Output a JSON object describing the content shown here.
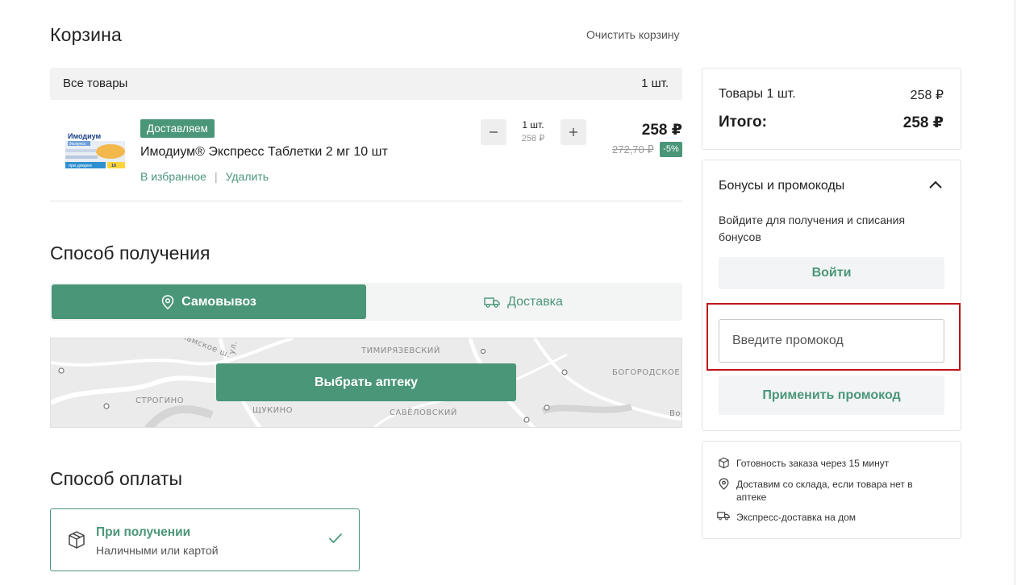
{
  "header": {
    "title": "Корзина",
    "clear_cart": "Очистить корзину"
  },
  "cart": {
    "all_items_label": "Все товары",
    "all_items_count": "1 шт.",
    "item": {
      "badge": "Доставляем",
      "name": "Имодиум® Экспресс Таблетки 2 мг 10 шт",
      "favorite": "В избранное",
      "separator": "|",
      "remove": "Удалить",
      "quantity": "1 шт.",
      "unit_price": "258 ₽",
      "price": "258 ₽",
      "old_price": "272,70 ₽",
      "discount": "-5%",
      "image_text": {
        "brand": "Имодиум",
        "sub": "Экспресс",
        "bottom": "при диарее",
        "count": "10"
      }
    }
  },
  "receive": {
    "title": "Способ получения",
    "tabs": [
      {
        "label": "Самовывоз",
        "icon": "location-pin-icon",
        "active": true
      },
      {
        "label": "Доставка",
        "icon": "truck-icon",
        "active": false
      }
    ],
    "choose_pharmacy": "Выбрать аптеку",
    "map_labels": {
      "timiryazevsky": "ТИМИРЯЗЕВСКИЙ",
      "bogorodskoe": "БОГОРОДСКОЕ",
      "strogino": "СТРОГИНО",
      "shchukino": "ЩУКИНО",
      "savelovsky": "САВЁЛОВСКИЙ",
      "street": "ламское ш.",
      "street2": "ул.",
      "edge": "Вос"
    }
  },
  "payment": {
    "title": "Способ оплаты",
    "option_title": "При получении",
    "option_sub": "Наличными или картой"
  },
  "summary": {
    "items_label": "Товары 1 шт.",
    "items_value": "258 ₽",
    "total_label": "Итого:",
    "total_value": "258 ₽"
  },
  "bonus": {
    "title": "Бонусы и промокоды",
    "description": "Войдите для получения и списания бонусов",
    "login_button": "Войти",
    "promo_placeholder": "Введите промокод",
    "apply_button": "Применить промокод"
  },
  "info": [
    {
      "icon": "box-icon",
      "text": "Готовность заказа через 15 минут"
    },
    {
      "icon": "location-pin-icon",
      "text": "Доставим со склада, если товара нет в аптеке"
    },
    {
      "icon": "truck-icon",
      "text": "Экспресс-доставка на дом"
    }
  ],
  "colors": {
    "accent": "#4a9678",
    "highlight": "#c0131c"
  }
}
